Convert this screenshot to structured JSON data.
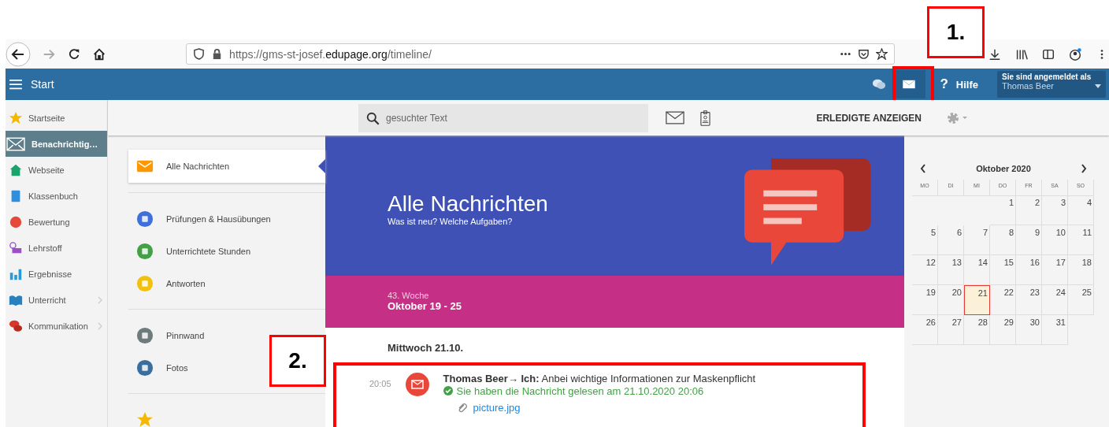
{
  "browser": {
    "url": "https://gms-st-josef.**edupage.org**/timeline/"
  },
  "app_bar": {
    "menu_label": "Start",
    "help_icon": "?",
    "help_label": "Hilfe",
    "login_label": "Sie sind angemeldet als",
    "user": "Thomas Beer"
  },
  "sidebar": {
    "items": [
      {
        "label": "Startseite",
        "kind": "star",
        "selected": false,
        "expandable": false
      },
      {
        "label": "Benachrichtig…",
        "kind": "mail",
        "selected": true,
        "expandable": false
      },
      {
        "label": "Webseite",
        "kind": "home",
        "selected": false,
        "expandable": false
      },
      {
        "label": "Klassenbuch",
        "kind": "book",
        "selected": false,
        "expandable": false
      },
      {
        "label": "Bewertung",
        "kind": "grade",
        "selected": false,
        "expandable": false
      },
      {
        "label": "Lehrstoff",
        "kind": "lesson",
        "selected": false,
        "expandable": false
      },
      {
        "label": "Ergebnisse",
        "kind": "chart",
        "selected": false,
        "expandable": false
      },
      {
        "label": "Unterricht",
        "kind": "openbook",
        "selected": false,
        "expandable": true
      },
      {
        "label": "Kommunikation",
        "kind": "chat",
        "selected": false,
        "expandable": true
      }
    ]
  },
  "toolbar": {
    "search_placeholder": "gesuchter Text",
    "done_button": "ERLEDIGTE ANZEIGEN"
  },
  "filters": {
    "groups": [
      [
        {
          "label": "Alle Nachrichten",
          "kind": "mail",
          "selected": true
        }
      ],
      [
        {
          "label": "Prüfungen & Hausübungen",
          "kind": "exam",
          "selected": false
        },
        {
          "label": "Unterrichtete Stunden",
          "kind": "person",
          "selected": false
        },
        {
          "label": "Antworten",
          "kind": "bars",
          "selected": false
        }
      ],
      [
        {
          "label": "Pinnwand",
          "kind": "board",
          "selected": false
        },
        {
          "label": "Fotos",
          "kind": "photo",
          "selected": false
        }
      ]
    ]
  },
  "banner": {
    "title": "Alle Nachrichten",
    "subtitle": "Was ist neu? Welche Aufgaben?"
  },
  "week": {
    "label": "43. Woche",
    "range": "Oktober 19 - 25"
  },
  "day_heading": "Mittwoch 21.10.",
  "messages": [
    {
      "time": "20:05",
      "text": "**Thomas Beer→ Ich:** Anbei wichtige Informationen zur Maskenpflicht",
      "read_note": "Sie haben die Nachricht gelesen am 21.10.2020 20:06",
      "attachment": "picture.jpg"
    }
  ],
  "calendar": {
    "month": "Oktober 2020",
    "weekdays": [
      "MO",
      "DI",
      "MI",
      "DO",
      "FR",
      "SA",
      "SO"
    ],
    "weeks": [
      [
        {
          "day": "1",
          "selected": false
        },
        {
          "day": "2",
          "selected": false
        },
        {
          "day": "3",
          "selected": false
        },
        {
          "day": "4",
          "selected": false
        }
      ],
      [
        {
          "day": "5",
          "selected": false
        },
        {
          "day": "6",
          "selected": false
        },
        {
          "day": "7",
          "selected": false
        },
        {
          "day": "8",
          "selected": false
        },
        {
          "day": "9",
          "selected": false
        },
        {
          "day": "10",
          "selected": false
        },
        {
          "day": "11",
          "selected": false
        }
      ],
      [
        {
          "day": "12",
          "selected": false
        },
        {
          "day": "13",
          "selected": false
        },
        {
          "day": "14",
          "selected": false
        },
        {
          "day": "15",
          "selected": false
        },
        {
          "day": "16",
          "selected": false
        },
        {
          "day": "17",
          "selected": false
        },
        {
          "day": "18",
          "selected": false
        }
      ],
      [
        {
          "day": "19",
          "selected": false
        },
        {
          "day": "20",
          "selected": false
        },
        {
          "day": "21",
          "selected": true
        },
        {
          "day": "22",
          "selected": false
        },
        {
          "day": "23",
          "selected": false
        },
        {
          "day": "24",
          "selected": false
        },
        {
          "day": "25",
          "selected": false
        }
      ],
      [
        {
          "day": "26",
          "selected": false
        },
        {
          "day": "27",
          "selected": false
        },
        {
          "day": "28",
          "selected": false
        },
        {
          "day": "29",
          "selected": false
        },
        {
          "day": "30",
          "selected": false
        },
        {
          "day": "31",
          "selected": false
        }
      ]
    ]
  },
  "annotations": [
    {
      "label": "1."
    },
    {
      "label": "2."
    }
  ]
}
